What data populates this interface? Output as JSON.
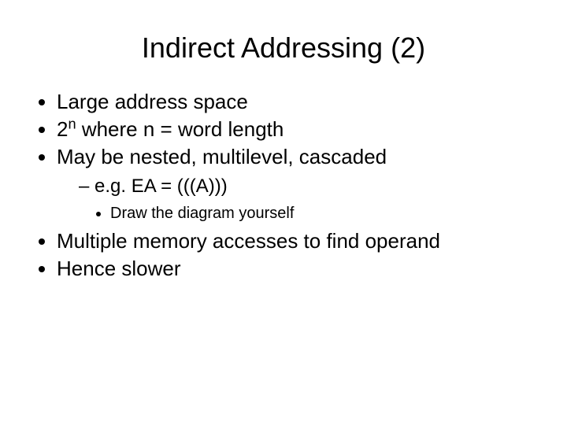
{
  "title": "Indirect Addressing (2)",
  "bullets": {
    "b1": "Large address space",
    "b2_pre": "2",
    "b2_sup": "n",
    "b2_post": " where n = word length",
    "b3": "May be nested, multilevel, cascaded",
    "b3_sub": "e.g. EA = (((A)))",
    "b3_sub_sub": "Draw the diagram yourself",
    "b4": "Multiple memory accesses to find operand",
    "b5": "Hence slower"
  }
}
